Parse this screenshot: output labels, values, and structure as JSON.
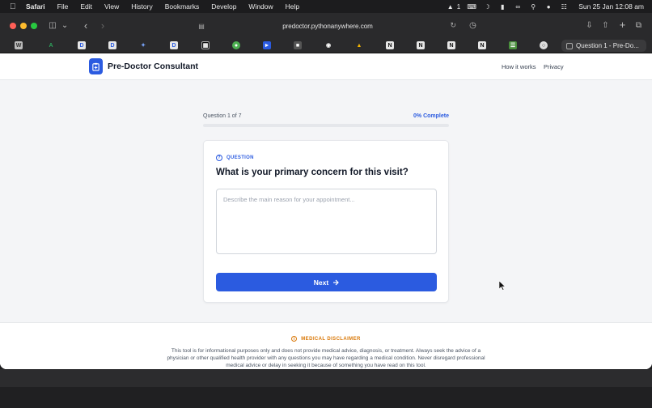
{
  "menubar": {
    "app_name": "Safari",
    "items": [
      "File",
      "Edit",
      "View",
      "History",
      "Bookmarks",
      "Develop",
      "Window",
      "Help"
    ],
    "status_count": "1",
    "clock": "Sun 25 Jan  12:08 am"
  },
  "browser": {
    "url": "predoctor.pythonanywhere.com",
    "active_tab_title": "Question 1 - Pre-Do..."
  },
  "site": {
    "brand": "Pre-Doctor Consultant",
    "nav": [
      "How it works",
      "Privacy"
    ],
    "accent_color": "#2b5be0"
  },
  "progress": {
    "label": "Question 1 of 7",
    "percent_text": "0% Complete",
    "value": 0
  },
  "question": {
    "tag": "QUESTION",
    "text": "What is your primary concern for this visit?",
    "answer_value": "",
    "placeholder": "Describe the main reason for your appointment...",
    "next_label": "Next"
  },
  "disclaimer": {
    "heading": "MEDICAL DISCLAIMER",
    "text": "This tool is for informational purposes only and does not provide medical advice, diagnosis, or treatment. Always seek the advice of a physician or other qualified health provider with any questions you may have regarding a medical condition. Never disregard professional medical advice or delay in seeking it because of something you have read on this tool."
  }
}
